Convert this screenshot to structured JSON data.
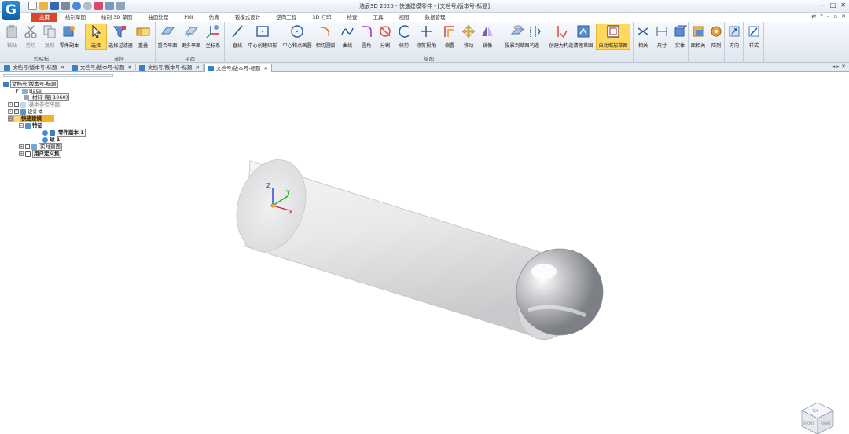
{
  "app": {
    "logo_glyph": "G",
    "window_title": "浩辰3D 2020 - 快速建模零件 - [文档号/版本号-标题]",
    "window_controls": [
      "—",
      "□",
      "✕"
    ]
  },
  "ribbon_tabs": [
    {
      "label": "主页",
      "active": true
    },
    {
      "label": "绘制草图"
    },
    {
      "label": "绘制 3D 草图"
    },
    {
      "label": "曲面处理"
    },
    {
      "label": "PMI"
    },
    {
      "label": "仿真"
    },
    {
      "label": "钣模式设计"
    },
    {
      "label": "逆向工程"
    },
    {
      "label": "3D 打印"
    },
    {
      "label": "检查"
    },
    {
      "label": "工具"
    },
    {
      "label": "视图"
    },
    {
      "label": "数据管理"
    }
  ],
  "tab_right_icons": [
    "⇄",
    "?",
    "–",
    "▫",
    "✕"
  ],
  "ribbon_groups": {
    "clipboard": "剪贴板",
    "select": "选择",
    "plane": "平面",
    "draw": "绘图"
  },
  "ribbon_buttons": {
    "paste": "粘贴",
    "cut": "剪切",
    "copy": "复制",
    "part_copy": "零件副本",
    "select": "选择",
    "select_filter": "选择过滤器",
    "overlap": "重叠",
    "coincident_plane": "重合平面",
    "more_planes": "更多平面",
    "coord_system": "坐标系",
    "line": "直线",
    "center_rect": "中心创建矩形",
    "center_circle": "中心和点画圆",
    "tangent_arc": "相切圆弧",
    "curve": "曲线",
    "fillet": "圆角",
    "split": "分割",
    "trim": "修剪",
    "trim_corner": "修剪拐角",
    "offset": "偏置",
    "move": "移动",
    "mirror": "镜像",
    "project_sketch": "投影到草图",
    "construct": "构造",
    "create_construct": "创建为构造",
    "clean_sketch": "清理草图",
    "auto_zoom": "自动缩放草图",
    "relate": "相关",
    "dimension": "尺寸",
    "solid": "实体",
    "face_related": "面相关",
    "pattern": "阵列",
    "direction": "方向",
    "style": "样式"
  },
  "doc_tabs": [
    {
      "label": "文档号/版本号-标题",
      "active": false
    },
    {
      "label": "文档号/版本号-标题",
      "active": false
    },
    {
      "label": "文档号/版本号-标题",
      "active": false
    },
    {
      "label": "文档号/版本号-标题",
      "active": true
    }
  ],
  "doc_tab_close": "✕",
  "doc_tab_arrows": "◂ ▸ ✕",
  "tree": {
    "root": "文档号/版本号-标题",
    "base": "Base",
    "material": "材料 (铝 1060)",
    "ref_planes": "基本参考平面",
    "design_body": "设计体",
    "quick_model": "快速建模",
    "features": "特征",
    "part_copy": "零件副本 1",
    "sphere": "球 1",
    "live_section": "实时剖面",
    "user_sets": "用户定义集"
  },
  "triad": {
    "x": "X",
    "y": "Y",
    "z": "Z"
  },
  "view_cube": {
    "top": "TOP",
    "front": "FRONT",
    "right": "RIGHT"
  },
  "colors": {
    "active_tab": "#d9472b",
    "highlight": "#ffd85e",
    "axis_x": "#e02020",
    "axis_y": "#18a818",
    "axis_z": "#2040d8",
    "app_blue": "#1a72c4"
  }
}
